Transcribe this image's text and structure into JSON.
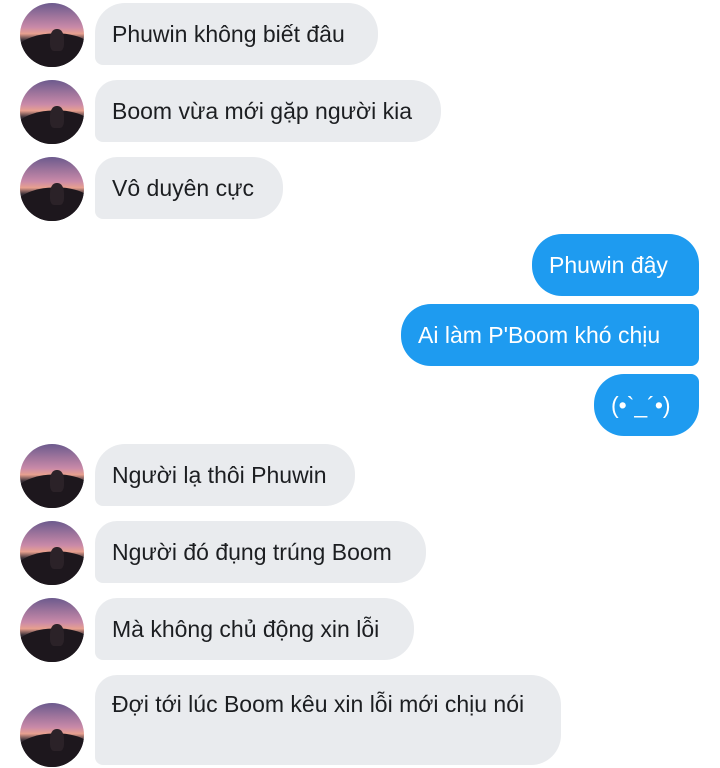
{
  "messages": [
    {
      "side": "in",
      "text": "Phuwin không biết đâu"
    },
    {
      "side": "in",
      "text": "Boom vừa mới gặp người kia"
    },
    {
      "side": "in",
      "text": "Vô duyên cực"
    },
    {
      "side": "out",
      "text": "Phuwin đây"
    },
    {
      "side": "out",
      "text": "Ai làm P'Boom khó chịu"
    },
    {
      "side": "out",
      "text": "(•`_´•)"
    },
    {
      "side": "in",
      "text": "Người lạ thôi Phuwin"
    },
    {
      "side": "in",
      "text": "Người đó đụng trúng Boom"
    },
    {
      "side": "in",
      "text": "Mà không chủ động xin lỗi"
    },
    {
      "side": "in",
      "text": "Đợi tới lúc Boom kêu xin lỗi mới chịu nói"
    }
  ],
  "colors": {
    "incoming_bubble": "#e9ebee",
    "outgoing_bubble": "#1e9bf0",
    "incoming_text": "#1c1e21",
    "outgoing_text": "#ffffff"
  },
  "icons": {
    "avatar": "contact-avatar-sunset-photo"
  }
}
